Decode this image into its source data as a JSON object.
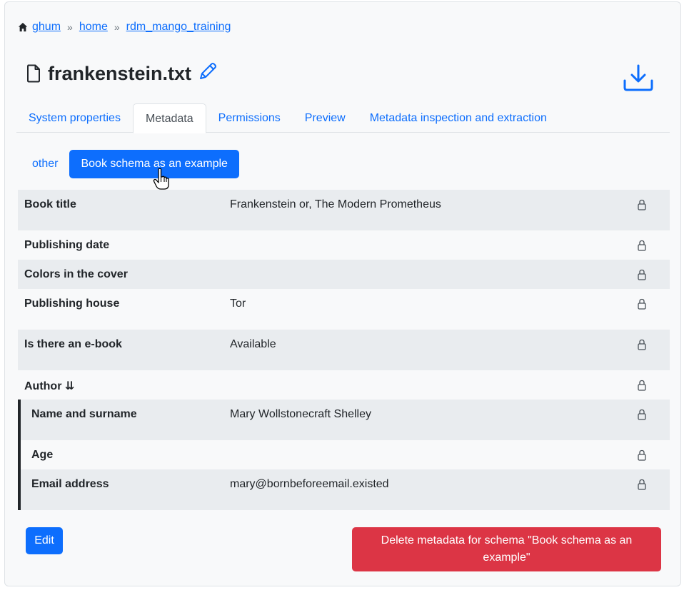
{
  "breadcrumb": {
    "items": [
      "ghum",
      "home",
      "rdm_mango_training"
    ],
    "separator": "»"
  },
  "file": {
    "title": "frankenstein.txt"
  },
  "tabs": [
    {
      "label": "System properties",
      "active": false
    },
    {
      "label": "Metadata",
      "active": true
    },
    {
      "label": "Permissions",
      "active": false
    },
    {
      "label": "Preview",
      "active": false
    },
    {
      "label": "Metadata inspection and extraction",
      "active": false
    }
  ],
  "schema_pills": [
    {
      "label": "other",
      "active": false
    },
    {
      "label": "Book schema as an example",
      "active": true
    }
  ],
  "metadata": {
    "rows": [
      {
        "label": "Book title",
        "value": "Frankenstein or, The Modern Prometheus"
      },
      {
        "label": "Publishing date",
        "value": ""
      },
      {
        "label": "Colors in the cover",
        "value": ""
      },
      {
        "label": "Publishing house",
        "value": "Tor"
      },
      {
        "label": "Is there an e-book",
        "value": "Available"
      },
      {
        "label": "Author ⇊",
        "value": ""
      }
    ],
    "author_rows": [
      {
        "label": "Name and surname",
        "value": "Mary Wollstonecraft Shelley"
      },
      {
        "label": "Age",
        "value": ""
      },
      {
        "label": "Email address",
        "value": "mary@bornbeforeemail.existed"
      }
    ]
  },
  "actions": {
    "edit_label": "Edit",
    "delete_label": "Delete metadata for schema \"Book schema as an example\""
  },
  "colors": {
    "primary": "#0d6efd",
    "danger": "#dc3545",
    "row_grey": "#e9ecef",
    "card_bg": "#f8f9fa"
  },
  "icons": [
    "home-icon",
    "file-icon",
    "pencil-icon",
    "download-icon",
    "lock-icon",
    "hand-cursor-icon"
  ]
}
